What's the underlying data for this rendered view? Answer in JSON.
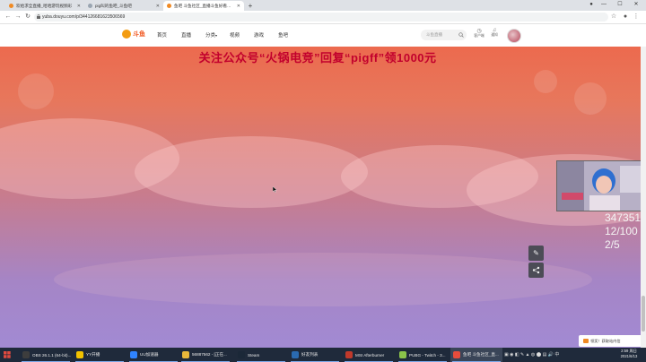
{
  "browser": {
    "tabs": [
      {
        "label": "欢给求全直播_哈哈游玩视频彩",
        "active": false
      },
      {
        "label": "pig叫的鱼吧_斗鱼吧",
        "active": false
      },
      {
        "label": "鱼吧 斗鱼社区_直播斗鱼好看的直",
        "active": true
      }
    ],
    "new_tab": "+",
    "url": "yuba.douyu.com/p/344126681623506569",
    "window_controls": [
      "—",
      "☐",
      "✕"
    ]
  },
  "site": {
    "logo_text": "斗鱼",
    "nav": [
      "首页",
      "直播",
      "分类",
      "视频",
      "游戏",
      "鱼吧"
    ],
    "search_placeholder": "斗鱼直播",
    "header_icons": [
      {
        "name": "history-icon",
        "label": "客户端"
      },
      {
        "name": "bell-icon",
        "label": "通知"
      }
    ]
  },
  "banner_text": "关注公众号“火锅电竞”回复“pigff”领1000元",
  "side_buttons": [
    "edit-icon",
    "share-icon"
  ],
  "overlay_numbers": [
    "347351",
    "12/100",
    "2/5"
  ],
  "notice_text": "领奖！获取站内信",
  "taskbar": {
    "items": [
      {
        "label": "OBS 26.1.1 (64-bit)...",
        "color": "#3d3d3d",
        "active": false
      },
      {
        "label": "YY开播",
        "color": "#f2c200",
        "active": false
      },
      {
        "label": "UU加速器",
        "color": "#2f84ff",
        "active": false
      },
      {
        "label": "56887562 - [正在...",
        "color": "#e9b83a",
        "active": false
      },
      {
        "label": "Steam",
        "color": "#1b2838",
        "active": false
      },
      {
        "label": "好友列表",
        "color": "#2a6ab0",
        "active": false
      },
      {
        "label": "MSI Afterburner",
        "color": "#c0392b",
        "active": false
      },
      {
        "label": "PUBG - Twitch - 3...",
        "color": "#8bc34a",
        "active": false
      },
      {
        "label": "鱼吧 斗鱼社区_直...",
        "color": "#e74c3c",
        "active": true
      }
    ],
    "time": "2:59 周日",
    "date": "2021/6/13"
  }
}
